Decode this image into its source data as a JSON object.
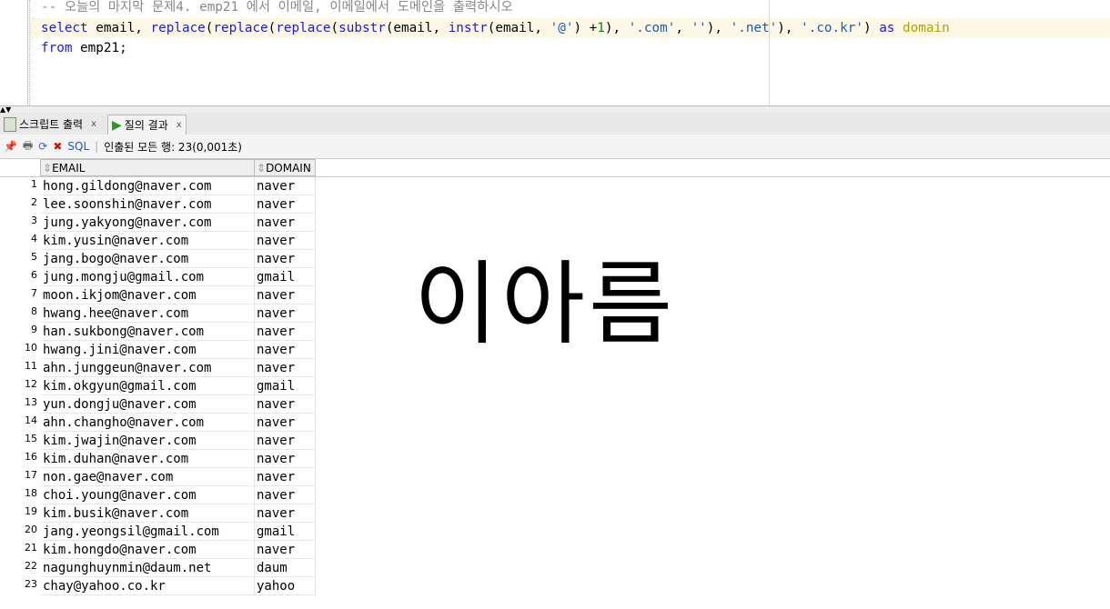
{
  "editor": {
    "line1": "-- 오늘의 마지막 문제4. emp21 에서 이메일, 이메일에서 도메인을 출력하시오",
    "line2": {
      "select": "select",
      "a": " email, ",
      "replace1": "replace",
      "p1": "(",
      "replace2": "replace",
      "p2": "(",
      "replace3": "replace",
      "p3": "(",
      "substr": "substr",
      "b": "(email, ",
      "instr": "instr",
      "c": "(email, ",
      "at": "'@'",
      "d": ") +",
      "one": "1",
      "e": "), ",
      "com": "'.com'",
      "f": ", ",
      "empty": "''",
      "g": "), ",
      "net": "'.net'",
      "h": "), ",
      "cokr": "'.co.kr'",
      "i": ") ",
      "as": "as",
      "j": " ",
      "domain": "domain"
    },
    "line3": {
      "from": "from",
      "rest": " emp21;"
    }
  },
  "tabs": [
    {
      "label": "스크립트 출력",
      "close": "x"
    },
    {
      "label": "질의 결과",
      "close": "x"
    }
  ],
  "toolbar": {
    "sql": "SQL",
    "status": "인출된 모든 행: 23(0,001초)"
  },
  "columns": [
    "EMAIL",
    "DOMAIN"
  ],
  "rows": [
    [
      "hong.gildong@naver.com",
      "naver"
    ],
    [
      "lee.soonshin@naver.com",
      "naver"
    ],
    [
      "jung.yakyong@naver.com",
      "naver"
    ],
    [
      "kim.yusin@naver.com",
      "naver"
    ],
    [
      "jang.bogo@naver.com",
      "naver"
    ],
    [
      "jung.mongju@gmail.com",
      "gmail"
    ],
    [
      "moon.ikjom@naver.com",
      "naver"
    ],
    [
      "hwang.hee@naver.com",
      "naver"
    ],
    [
      "han.sukbong@naver.com",
      "naver"
    ],
    [
      "hwang.jini@naver.com",
      "naver"
    ],
    [
      "ahn.junggeun@naver.com",
      "naver"
    ],
    [
      "kim.okgyun@gmail.com",
      "gmail"
    ],
    [
      "yun.dongju@naver.com",
      "naver"
    ],
    [
      "ahn.changho@naver.com",
      "naver"
    ],
    [
      "kim.jwajin@naver.com",
      "naver"
    ],
    [
      "kim.duhan@naver.com",
      "naver"
    ],
    [
      "non.gae@naver.com",
      "naver"
    ],
    [
      "choi.young@naver.com",
      "naver"
    ],
    [
      "kim.busik@naver.com",
      "naver"
    ],
    [
      "jang.yeongsil@gmail.com",
      "gmail"
    ],
    [
      "kim.hongdo@naver.com",
      "naver"
    ],
    [
      "nagunghuynmin@daum.net",
      "daum"
    ],
    [
      "chay@yahoo.co.kr",
      "yahoo"
    ]
  ],
  "handwriting": "이아름"
}
